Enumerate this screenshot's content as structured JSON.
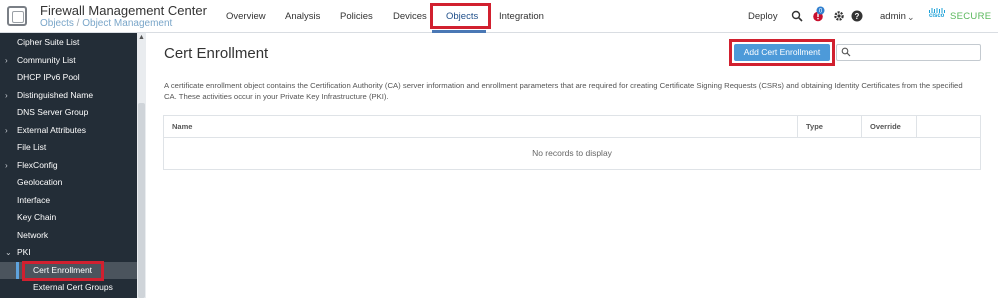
{
  "header": {
    "app_title": "Firewall Management Center",
    "breadcrumb_root": "Objects",
    "breadcrumb_sep": " / ",
    "breadcrumb_current": "Object Management",
    "nav": [
      "Overview",
      "Analysis",
      "Policies",
      "Devices",
      "Objects",
      "Integration"
    ],
    "active_nav": "Objects",
    "deploy_label": "Deploy",
    "user_label": "admin",
    "brand_cisco": "cisco",
    "brand_secure": "SECURE",
    "notification_badge": "0"
  },
  "sidebar": {
    "items": [
      {
        "label": "Cipher Suite List",
        "caret": ""
      },
      {
        "label": "Community List",
        "caret": "›"
      },
      {
        "label": "DHCP IPv6 Pool",
        "caret": ""
      },
      {
        "label": "Distinguished Name",
        "caret": "›"
      },
      {
        "label": "DNS Server Group",
        "caret": ""
      },
      {
        "label": "External Attributes",
        "caret": "›"
      },
      {
        "label": "File List",
        "caret": ""
      },
      {
        "label": "FlexConfig",
        "caret": "›"
      },
      {
        "label": "Geolocation",
        "caret": ""
      },
      {
        "label": "Interface",
        "caret": ""
      },
      {
        "label": "Key Chain",
        "caret": ""
      },
      {
        "label": "Network",
        "caret": ""
      },
      {
        "label": "PKI",
        "caret": "⌄"
      },
      {
        "label": "Cert Enrollment",
        "caret": ""
      },
      {
        "label": "External Cert Groups",
        "caret": ""
      }
    ]
  },
  "main": {
    "title": "Cert Enrollment",
    "add_button_label": "Add Cert Enrollment",
    "search_placeholder": "",
    "description": "A certificate enrollment object contains the Certification Authority (CA) server information and enrollment parameters that are required for creating Certificate Signing Requests (CSRs) and obtaining Identity Certificates from the specified CA. These activities occur in your Private Key Infrastructure (PKI).",
    "table": {
      "columns": [
        "Name",
        "Type",
        "Override"
      ],
      "empty_message": "No records to display"
    }
  },
  "colors": {
    "accent": "#4d9ad9",
    "sidebar_bg": "#232d37",
    "highlight": "#d1202f",
    "brand_green": "#5ab85c"
  }
}
